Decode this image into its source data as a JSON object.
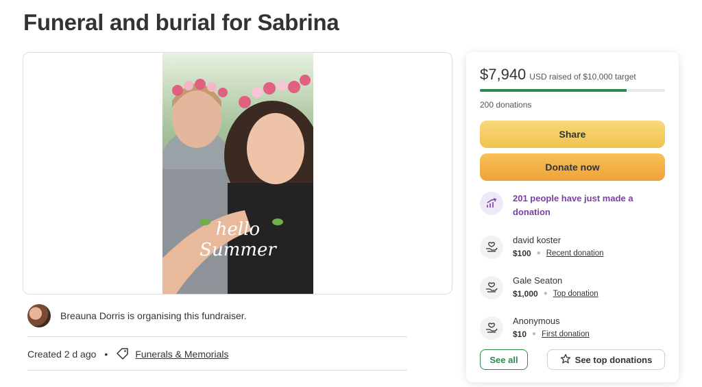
{
  "page": {
    "title": "Funeral and burial for Sabrina"
  },
  "photo": {
    "overlay_text_1": "hello",
    "overlay_text_2": "Summer"
  },
  "organiser": {
    "text": "Breauna Dorris is organising this fundraiser."
  },
  "meta": {
    "created": "Created 2 d ago",
    "separator": "•",
    "category": "Funerals & Memorials"
  },
  "donation_card": {
    "amount": "$7,940",
    "raised_text": "USD raised of $10,000 target",
    "progress_fraction": 0.794,
    "donations_count": "200 donations",
    "share_label": "Share",
    "donate_label": "Donate now",
    "trend_text": "201 people have just made a donation",
    "donors": [
      {
        "name": "david koster",
        "amount": "$100",
        "tag": "Recent donation"
      },
      {
        "name": "Gale Seaton",
        "amount": "$1,000",
        "tag": "Top donation"
      },
      {
        "name": "Anonymous",
        "amount": "$10",
        "tag": "First donation"
      }
    ],
    "see_all_label": "See all",
    "see_top_label": "See top donations"
  },
  "colors": {
    "green": "#2a8a4b",
    "purple": "#7b3fa3",
    "share_yellow": "#f1c24f",
    "donate_orange": "#f0a23a"
  },
  "icons": [
    "tag-icon",
    "trend-up-icon",
    "donation-hand-icon",
    "star-icon"
  ]
}
